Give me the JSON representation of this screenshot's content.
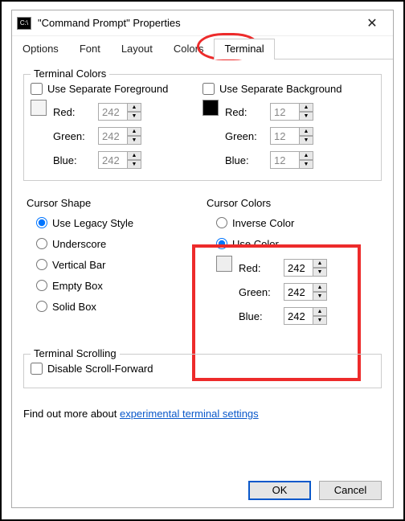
{
  "title": "\"Command Prompt\" Properties",
  "tabs": {
    "options": "Options",
    "font": "Font",
    "layout": "Layout",
    "colors": "Colors",
    "terminal": "Terminal"
  },
  "terminalColors": {
    "legend": "Terminal Colors",
    "fgCheck": "Use Separate Foreground",
    "bgCheck": "Use Separate Background",
    "redLabel": "Red:",
    "greenLabel": "Green:",
    "blueLabel": "Blue:",
    "fg": {
      "r": "242",
      "g": "242",
      "b": "242"
    },
    "bg": {
      "r": "12",
      "g": "12",
      "b": "12"
    }
  },
  "cursorShape": {
    "legend": "Cursor Shape",
    "options": {
      "legacy": "Use Legacy Style",
      "underscore": "Underscore",
      "vbar": "Vertical Bar",
      "empty": "Empty Box",
      "solid": "Solid Box"
    }
  },
  "cursorColors": {
    "legend": "Cursor Colors",
    "inverse": "Inverse Color",
    "useColor": "Use Color",
    "redLabel": "Red:",
    "greenLabel": "Green:",
    "blueLabel": "Blue:",
    "r": "242",
    "g": "242",
    "b": "242"
  },
  "terminalScrolling": {
    "legend": "Terminal Scrolling",
    "disable": "Disable Scroll-Forward"
  },
  "footer": {
    "prefix": "Find out more about ",
    "link": "experimental terminal settings"
  },
  "buttons": {
    "ok": "OK",
    "cancel": "Cancel"
  }
}
